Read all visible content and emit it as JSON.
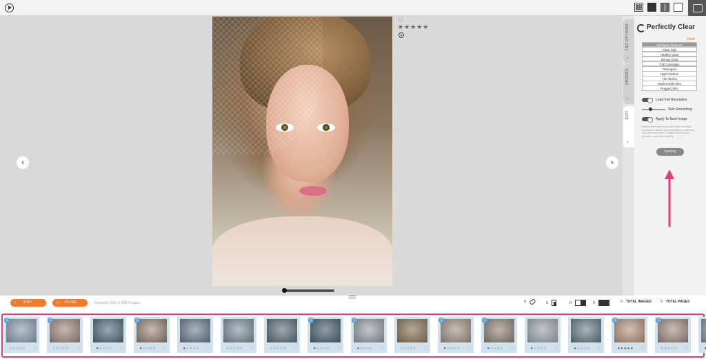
{
  "toolbar": {
    "play_icon": "play-circle-icon",
    "view_modes": [
      "grid-view-icon",
      "single-view-icon",
      "compare-view-icon",
      "blank-view-icon"
    ],
    "corner_icon": "album-icon"
  },
  "viewer": {
    "photo_alt": "Bride portrait with birdcage veil",
    "favorite_icon": "♡",
    "rating": "★★★★★",
    "prev_icon": "‹",
    "next_icon": "›"
  },
  "side_tabs": [
    {
      "label": "TAG OPTIONS",
      "chevron": "›"
    },
    {
      "label": "ORDERS",
      "chevron": "›"
    },
    {
      "label": "EDIT",
      "chevron": "›"
    }
  ],
  "panel": {
    "title": "Perfectly Clear",
    "clear_link": "Clear",
    "presets": [
      "Intelligent Retouch",
      "Clear Skin",
      "Healthy Glow",
      "Strong Glow",
      "Full Coverage",
      "Teenagers",
      "High Fashion",
      "The Works",
      "Supermodel Skin",
      "Rugged Skin"
    ],
    "active_preset": "Intelligent Retouch",
    "load_full_resolution": "Load Full Resolution",
    "skin_smoothing": "Skin Smoothing",
    "apply_next": "Apply To Next Image",
    "note": "Fastest thumbnail works with lower resolution previews for speed, and resampling results may vary from final export. Enable full resolution preview to see export quality.",
    "syncing_button": "Syncing"
  },
  "controls": {
    "sort_label": "SORT",
    "filter_label": "FILTER",
    "showing_text": "Showing 328 of 328 images",
    "counts": [
      "0",
      "0",
      "0",
      "0"
    ],
    "total_images_count": "0",
    "total_images_label": "TOTAL IMAGES",
    "total_pages_count": "0",
    "total_pages_label": "TOTAL PAGES"
  },
  "colors": {
    "accent_orange": "#f07b2d",
    "annotation_pink": "#e5397a",
    "badge_blue": "#5aa5d8"
  },
  "filmstrip": [
    {
      "badge": "1",
      "stars": "☆☆☆☆☆",
      "heart": "♡"
    },
    {
      "badge": "1",
      "stars": "☆☆☆☆☆",
      "heart": "♡"
    },
    {
      "badge": "",
      "stars": "★☆☆☆☆",
      "heart": "♡"
    },
    {
      "badge": "1",
      "stars": "★☆☆☆☆",
      "heart": "♡"
    },
    {
      "badge": "",
      "stars": "★☆☆☆☆",
      "heart": "♡"
    },
    {
      "badge": "",
      "stars": "☆☆☆☆☆",
      "heart": "♡"
    },
    {
      "badge": "",
      "stars": "☆☆☆☆☆",
      "heart": "♡"
    },
    {
      "badge": "1",
      "stars": "★☆☆☆☆",
      "heart": "♡"
    },
    {
      "badge": "1",
      "stars": "★☆☆☆☆",
      "heart": "♡"
    },
    {
      "badge": "",
      "stars": "☆☆☆☆☆",
      "heart": "♡"
    },
    {
      "badge": "1",
      "stars": "★☆☆☆☆",
      "heart": "♡"
    },
    {
      "badge": "1",
      "stars": "★☆☆☆☆",
      "heart": "♡"
    },
    {
      "badge": "",
      "stars": "★☆☆☆☆",
      "heart": "♡"
    },
    {
      "badge": "",
      "stars": "★☆☆☆☆",
      "heart": "♡"
    },
    {
      "badge": "1",
      "stars": "★★★★★",
      "heart": "♡"
    },
    {
      "badge": "1",
      "stars": "☆☆☆☆☆",
      "heart": "♡"
    },
    {
      "badge": "",
      "stars": "★☆☆☆☆",
      "heart": "♡"
    }
  ]
}
